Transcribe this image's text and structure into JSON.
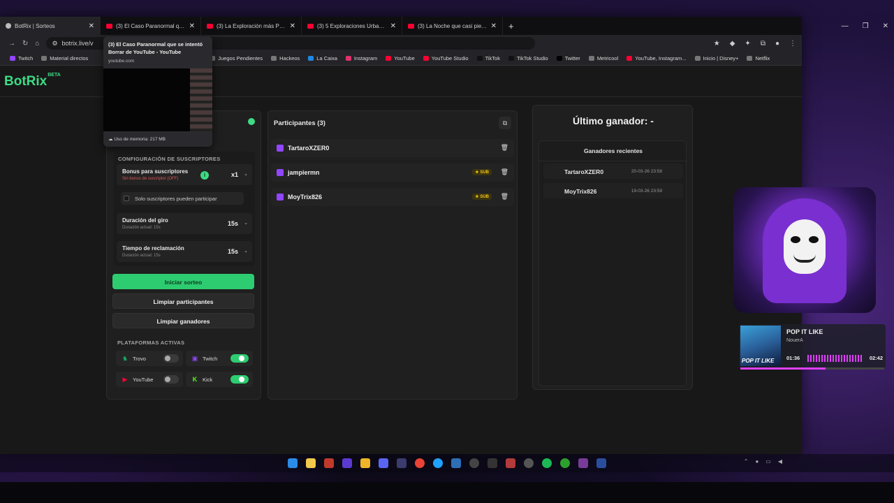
{
  "browser": {
    "tabs": [
      {
        "title": "BotRix | Sorteos",
        "active": true,
        "favicon": "botrix-icon"
      },
      {
        "title": "(3) El Caso Paranormal que se in",
        "active": false,
        "favicon": "youtube-icon"
      },
      {
        "title": "(3) La Exploración más Peligros",
        "active": false,
        "favicon": "youtube-icon"
      },
      {
        "title": "(3) 5 Exploraciones Urbanas qu",
        "active": false,
        "favicon": "youtube-icon"
      },
      {
        "title": "(3) La Noche que casi pierde la",
        "active": false,
        "favicon": "youtube-icon"
      }
    ],
    "new_tab": "+",
    "url": "botrix.live/v",
    "bookmarks": [
      "Twitch",
      "Material directos",
      "Juegos Pendientes",
      "Hackeos",
      "La Caixa",
      "Instagram",
      "YouTube",
      "YouTube Studio",
      "TikTok",
      "TikTok Studio",
      "Twitter",
      "Metricool",
      "YouTube, Instagram...",
      "Inicio | Disney+",
      "Netflix"
    ],
    "tab_popup": {
      "title": "(3) El Caso Paranormal que se intentó Borrar de YouTube - YouTube",
      "url": "youtube.com",
      "memory": "Uso de memoria: 217 MB"
    }
  },
  "app": {
    "brand": "BotRix",
    "brand_badge": "BETA",
    "config": {
      "section_title": "CONFIGURACIÓN DE SUSCRIPTORES",
      "bonus": {
        "title": "Bonus para suscriptores",
        "subtitle": "Sin bonus de suscriptor (OFF)",
        "value": "x1"
      },
      "only_subs": "Solo suscriptores pueden participar",
      "spin": {
        "title": "Duración del giro",
        "subtitle": "Duración actual: 15s",
        "value": "15s"
      },
      "claim": {
        "title": "Tiempo de reclamación",
        "subtitle": "Duración actual: 15s",
        "value": "15s"
      }
    },
    "buttons": {
      "start": "Iniciar sorteo",
      "clear_participants": "Limpiar participantes",
      "clear_winners": "Limpiar ganadores"
    },
    "platforms": {
      "title": "PLATAFORMAS ACTIVAS",
      "items": [
        {
          "name": "Trovo",
          "enabled": false,
          "color": "#1aab62"
        },
        {
          "name": "Twitch",
          "enabled": true,
          "color": "#9146ff"
        },
        {
          "name": "YouTube",
          "enabled": false,
          "color": "#ff0033"
        },
        {
          "name": "Kick",
          "enabled": true,
          "color": "#53fc18"
        }
      ]
    },
    "participants": {
      "title": "Participantes (3)",
      "rows": [
        {
          "name": "TartaroXZER0",
          "sub": false
        },
        {
          "name": "jampiermn",
          "sub": true
        },
        {
          "name": "MoyTrix826",
          "sub": true
        }
      ],
      "sub_badge": "★ SUB"
    },
    "winner": {
      "title": "Último ganador: -",
      "recent_title": "Ganadores recientes",
      "recent": [
        {
          "name": "TartaroXZER0",
          "date": "20-03-26 23:58"
        },
        {
          "name": "MoyTrix826",
          "date": "19-03-26 23:59"
        }
      ]
    }
  },
  "overlay": {
    "song": "POP IT LIKE",
    "artist": "NouerA",
    "cover_text": "POP IT LIKE",
    "time_current": "01:36",
    "time_total": "02:42",
    "progress": 0.59
  },
  "colors": {
    "accent": "#3ddc84",
    "twitch": "#9146ff",
    "youtube": "#ff0033",
    "sub": "#f5c518"
  }
}
